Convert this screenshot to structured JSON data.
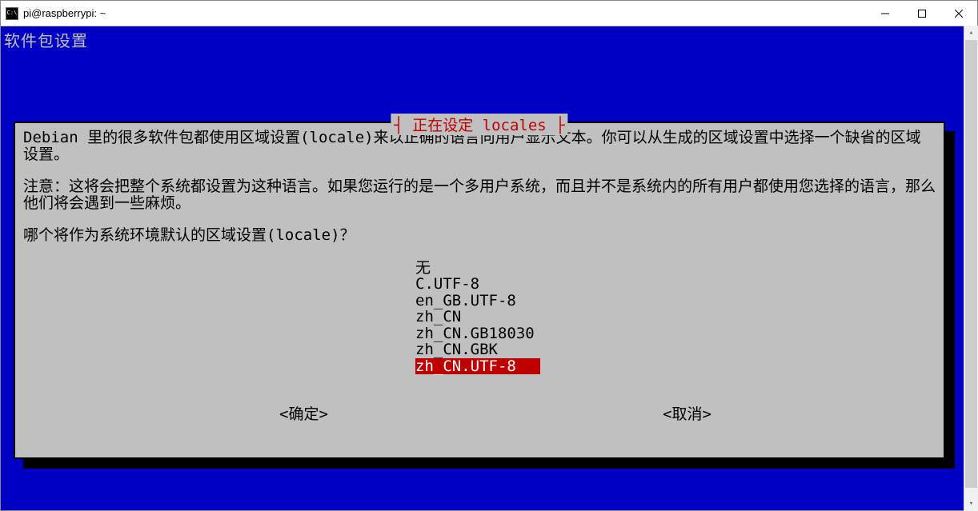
{
  "window": {
    "title": "pi@raspberrypi: ~"
  },
  "app": {
    "header": "软件包设置"
  },
  "dialog": {
    "title": "┤ 正在设定 locales ├",
    "para1": "Debian 里的很多软件包都使用区域设置(locale)来以正确的语言向用户显示文本。你可以从生成的区域设置中选择一个缺省的区域设置。",
    "para2": "注意：这将会把整个系统都设置为这种语言。如果您运行的是一个多用户系统，而且并不是系统内的所有用户都使用您选择的语言，那么他们将会遇到一些麻烦。",
    "prompt": "哪个将作为系统环境默认的区域设置(locale)？",
    "options": [
      {
        "label": "无",
        "selected": false
      },
      {
        "label": "C.UTF-8",
        "selected": false
      },
      {
        "label": "en_GB.UTF-8",
        "selected": false
      },
      {
        "label": "zh_CN",
        "selected": false
      },
      {
        "label": "zh_CN.GB18030",
        "selected": false
      },
      {
        "label": "zh_CN.GBK",
        "selected": false
      },
      {
        "label": "zh_CN.UTF-8",
        "selected": true
      }
    ],
    "ok_label": "<确定>",
    "cancel_label": "<取消>"
  }
}
